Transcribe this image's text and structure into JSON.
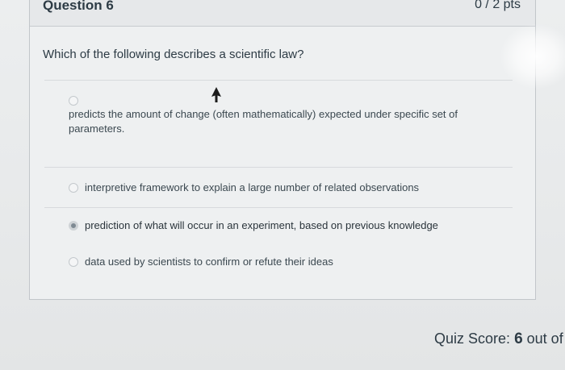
{
  "question": {
    "title": "Question 6",
    "points": "0 / 2 pts",
    "text": "Which of the following describes a scientific law?",
    "answers": [
      {
        "label": "predicts the amount of change (often mathematically) expected under specific set of parameters.",
        "selected": false
      },
      {
        "label": "interpretive framework to explain a large number of related observations",
        "selected": false
      },
      {
        "label": "prediction of what will occur in an experiment, based on previous knowledge",
        "selected": true
      },
      {
        "label": "data used by scientists to confirm or refute their ideas",
        "selected": false
      }
    ]
  },
  "quiz_score": {
    "label": "Quiz Score:",
    "score": "6",
    "suffix": "out of"
  },
  "colors": {
    "text": "#2d3b45",
    "border": "#c2c6ca",
    "selected_radio": "#7f8a93"
  },
  "icons": [
    "mouse-cursor-icon",
    "radio-button-icon"
  ]
}
